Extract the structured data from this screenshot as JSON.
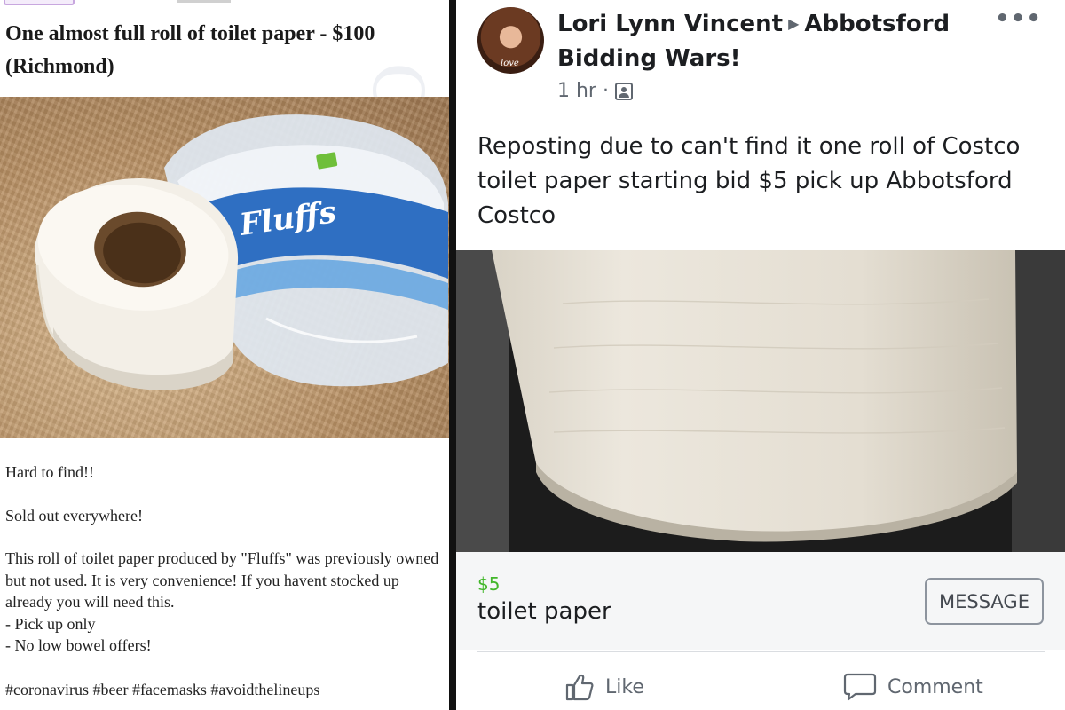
{
  "listing": {
    "title": "One almost full roll of toilet paper - $100 (Richmond)",
    "photo": {
      "brand_text": "Fluffs"
    },
    "body": {
      "line1": "Hard to find!!",
      "line2": "Sold out everywhere!",
      "paragraph": "This roll of toilet paper produced by \"Fluffs\" was previously owned but not used. It is very convenience! If you havent stocked up already you will need this.",
      "bullet1": "- Pick up only",
      "bullet2": "- No low bowel offers!",
      "hashtags": "#coronavirus #beer #facemasks #avoidthelineups"
    }
  },
  "post": {
    "author": "Lori Lynn Vincent",
    "group": "Abbotsford Bidding Wars!",
    "time": "1 hr",
    "text": "Reposting due to can't find it one roll of Costco toilet paper starting bid $5 pick up Abbotsford Costco",
    "item": {
      "price": "$5",
      "name": "toilet paper",
      "message_label": "MESSAGE"
    },
    "actions": {
      "like_label": "Like",
      "comment_label": "Comment"
    }
  },
  "icons": {
    "more": "more-options-icon",
    "group": "group-icon",
    "like": "thumbs-up-icon",
    "comment": "comment-bubble-icon"
  },
  "colors": {
    "price_green": "#42b72a",
    "text_dark": "#1c1e21",
    "text_grey": "#606770"
  }
}
